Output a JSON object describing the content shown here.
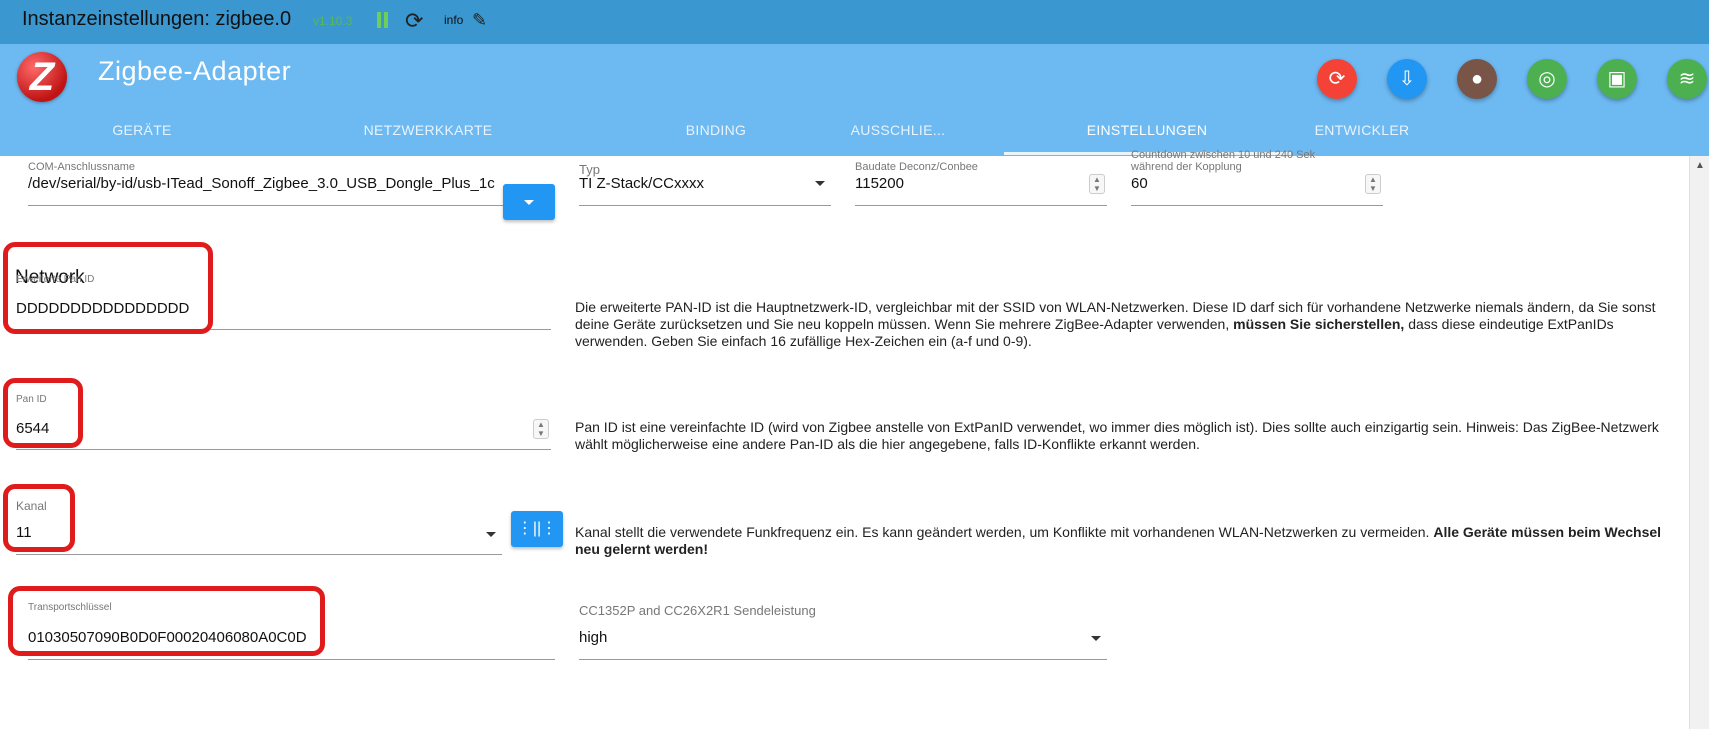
{
  "titlebar": {
    "title": "Instanzeinstellungen: zigbee.0",
    "version": "v1.10.3",
    "info_label": "info",
    "icons": [
      "pause-icon",
      "reload-icon",
      "pencil-icon"
    ]
  },
  "header": {
    "app_title": "Zigbee-Adapter",
    "logo_letter": "Z",
    "buttons": [
      {
        "name": "refresh-icon",
        "glyph": "⟳",
        "color": "#f44336"
      },
      {
        "name": "phone-download-icon",
        "glyph": "⇩",
        "color": "#2196f3"
      },
      {
        "name": "bee-icon",
        "glyph": "●",
        "color": "#795548"
      },
      {
        "name": "signal-icon",
        "glyph": "◎",
        "color": "#4caf50"
      },
      {
        "name": "chip-icon",
        "glyph": "▣",
        "color": "#4caf50"
      },
      {
        "name": "zigbee-icon",
        "glyph": "≋",
        "color": "#4caf50"
      }
    ]
  },
  "tabs": [
    {
      "label": "GERÄTE",
      "active": false
    },
    {
      "label": "NETZWERKKARTE",
      "active": false
    },
    {
      "label": "BINDING",
      "active": false
    },
    {
      "label": "AUSSCHLIE...",
      "active": false
    },
    {
      "label": "EINSTELLUNGEN",
      "active": true
    },
    {
      "label": "ENTWICKLER",
      "active": false
    }
  ],
  "settings": {
    "com_port": {
      "label": "COM-Anschlussname",
      "value": "/dev/serial/by-id/usb-ITead_Sonoff_Zigbee_3.0_USB_Dongle_Plus_1c"
    },
    "typ": {
      "label": "Typ",
      "value": "TI Z-Stack/CCxxxx"
    },
    "baudrate": {
      "label": "Baudate Deconz/Conbee",
      "value": "115200"
    },
    "countdown": {
      "label_line1": "Countdown zwischen 10 und 240 Sek",
      "label_line2": "während der Kopplung",
      "value": "60"
    },
    "network_heading": "Network",
    "ext_pan_id": {
      "label": "Erweiterte Pan ID",
      "value": "DDDDDDDDDDDDDDDD",
      "desc_part1": "Die erweiterte PAN-ID ist die Hauptnetzwerk-ID, vergleichbar mit der SSID von WLAN-Netzwerken. Diese ID darf sich für vorhandene Netzwerke niemals ändern, da Sie sonst deine Geräte zurücksetzen und Sie neu koppeln müssen. Wenn Sie mehrere ZigBee-Adapter verwenden, ",
      "desc_bold": "müssen Sie sicherstellen,",
      "desc_part2": " dass diese eindeutige ExtPanIDs verwenden. Geben Sie einfach 16 zufällige Hex-Zeichen ein (a-f und 0-9)."
    },
    "pan_id": {
      "label": "Pan ID",
      "value": "6544",
      "desc": "Pan ID ist eine vereinfachte ID (wird von Zigbee anstelle von ExtPanID verwendet, wo immer dies möglich ist). Dies sollte auch einzigartig sein. Hinweis: Das ZigBee-Netzwerk wählt möglicherweise eine andere Pan-ID als die hier angegebene, falls ID-Konflikte erkannt werden."
    },
    "kanal": {
      "label": "Kanal",
      "value": "11",
      "desc_part1": "Kanal stellt die verwendete Funkfrequenz ein. Es kann geändert werden, um Konflikte mit vorhandenen WLAN-Netzwerken zu vermeiden. ",
      "desc_bold": "Alle Geräte müssen beim Wechsel neu gelernt werden!"
    },
    "transport_key": {
      "label": "Transportschlüssel",
      "value": "01030507090B0D0F00020406080A0C0D"
    },
    "tx_power": {
      "label": "CC1352P and CC26X2R1 Sendeleistung",
      "value": "high"
    }
  },
  "colors": {
    "titlebar": "#3a97cf",
    "header": "#6db9f2",
    "accent_button": "#2196f3",
    "highlight_box": "#e01b1b"
  }
}
